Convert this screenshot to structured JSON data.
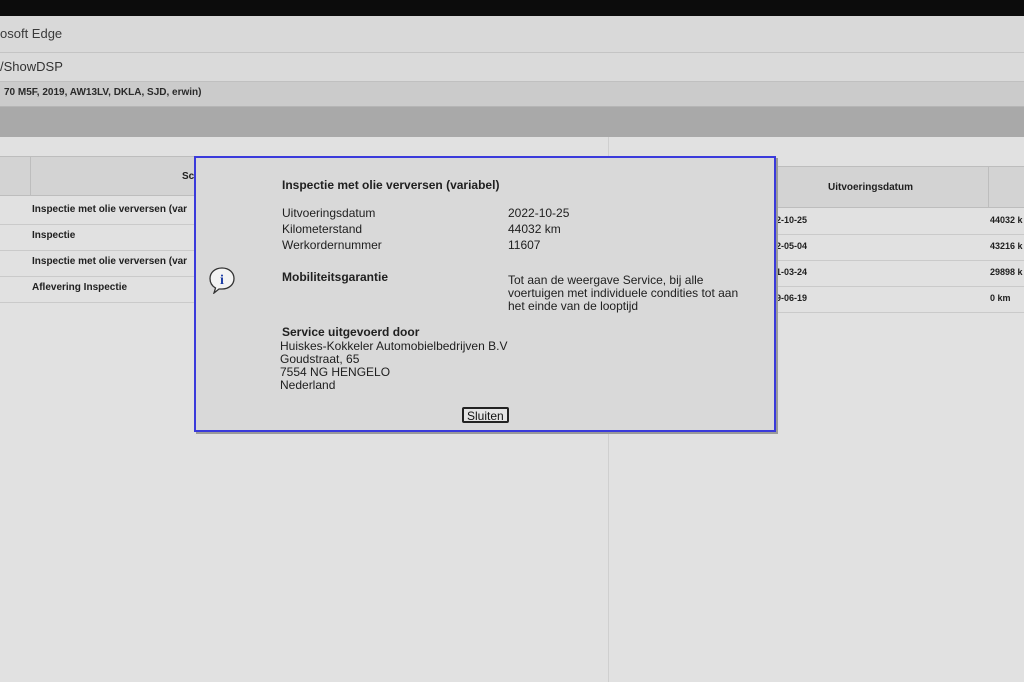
{
  "window": {
    "title": "osoft Edge",
    "address": "/ShowDSP"
  },
  "vehicle_info": "70 M5F, 2019, AW13LV, DKLA, SJD, erwin)",
  "table": {
    "header_left": "Sc",
    "header_date": "Uitvoeringsdatum",
    "rows": [
      {
        "label": "Inspectie met olie verversen (var",
        "date": "2-10-25",
        "km": "44032 k"
      },
      {
        "label": "Inspectie",
        "date": "2-05-04",
        "km": "43216 k"
      },
      {
        "label": "Inspectie met olie verversen (var",
        "date": "1-03-24",
        "km": "29898 k"
      },
      {
        "label": "Aflevering Inspectie",
        "date": "9-06-19",
        "km": "0 km"
      }
    ]
  },
  "dialog": {
    "title": "Inspectie met olie verversen (variabel)",
    "fields": [
      {
        "label": "Uitvoeringsdatum",
        "value": "2022-10-25"
      },
      {
        "label": "Kilometerstand",
        "value": "44032 km"
      },
      {
        "label": "Werkordernummer",
        "value": "11607"
      }
    ],
    "icon": "info-icon",
    "mobility_label": "Mobiliteitsgarantie",
    "mobility_text": "Tot aan de weergave Service, bij alle voertuigen met individuele condities tot aan het einde van de looptijd",
    "service_title": "Service uitgevoerd door",
    "address_lines": [
      "Huiskes-Kokkeler Automobielbedrijven B.V",
      "Goudstraat, 65",
      "7554 NG HENGELO",
      "Nederland"
    ],
    "close_label": "Sluiten"
  },
  "colors": {
    "dialog_border": "#3a3adb",
    "dialog_bg": "#d9d9d9"
  }
}
